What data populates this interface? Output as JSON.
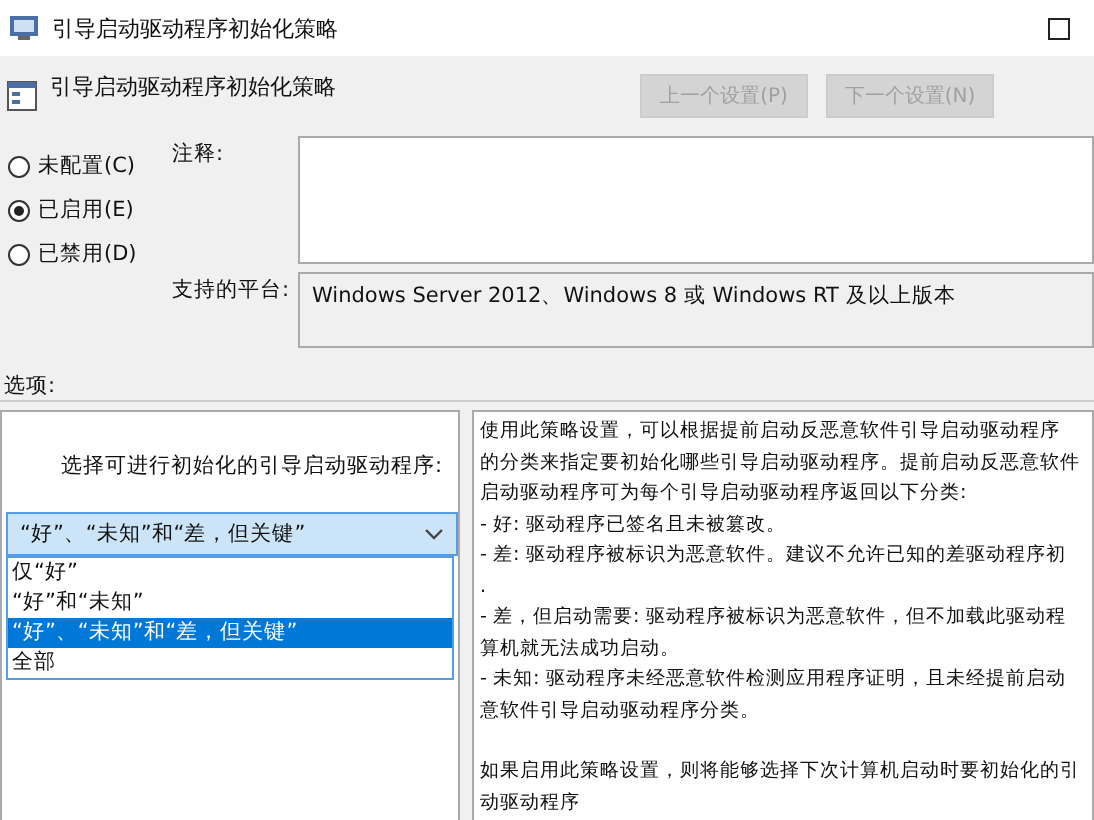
{
  "window": {
    "title": "引导启动驱动程序初始化策略"
  },
  "header": {
    "title": "引导启动驱动程序初始化策略",
    "buttons": [
      {
        "label": "上一个设置(P)",
        "disabled": true
      },
      {
        "label": "下一个设置(N)",
        "disabled": true
      }
    ]
  },
  "state_options": [
    {
      "label": "未配置(C)",
      "selected": false
    },
    {
      "label": "已启用(E)",
      "selected": true
    },
    {
      "label": "已禁用(D)",
      "selected": false
    }
  ],
  "comment": {
    "label": "注释:"
  },
  "platform": {
    "label": "支持的平台:",
    "value": "Windows Server 2012、Windows 8 或 Windows RT 及以上版本"
  },
  "options_label": "选项:",
  "options": {
    "prompt": "选择可进行初始化的引导启动驱动程序:",
    "combo_value": "“好”、“未知”和“差，但关键”",
    "dropdown": [
      {
        "label": "仅“好”",
        "selected": false
      },
      {
        "label": "“好”和“未知”",
        "selected": false
      },
      {
        "label": "“好”、“未知”和“差，但关键”",
        "selected": true
      },
      {
        "label": "全部",
        "selected": false
      }
    ]
  },
  "help_lines": [
    "使用此策略设置，可以根据提前启动反恶意软件引导启动驱动程序",
    "的分类来指定要初始化哪些引导启动驱动程序。提前启动反恶意软件",
    "启动驱动程序可为每个引导启动驱动程序返回以下分类:",
    "- 好: 驱动程序已签名且未被篡改。",
    "- 差: 驱动程序被标识为恶意软件。建议不允许已知的差驱动程序初",
    ".",
    "- 差，但启动需要: 驱动程序被标识为恶意软件，但不加载此驱动程",
    "算机就无法成功启动。",
    "- 未知: 驱动程序未经恶意软件检测应用程序证明，且未经提前启动",
    "意软件引导启动驱动程序分类。",
    "如果启用此策略设置，则将能够选择下次计算机启动时要初始化的引",
    "动驱动程序"
  ]
}
